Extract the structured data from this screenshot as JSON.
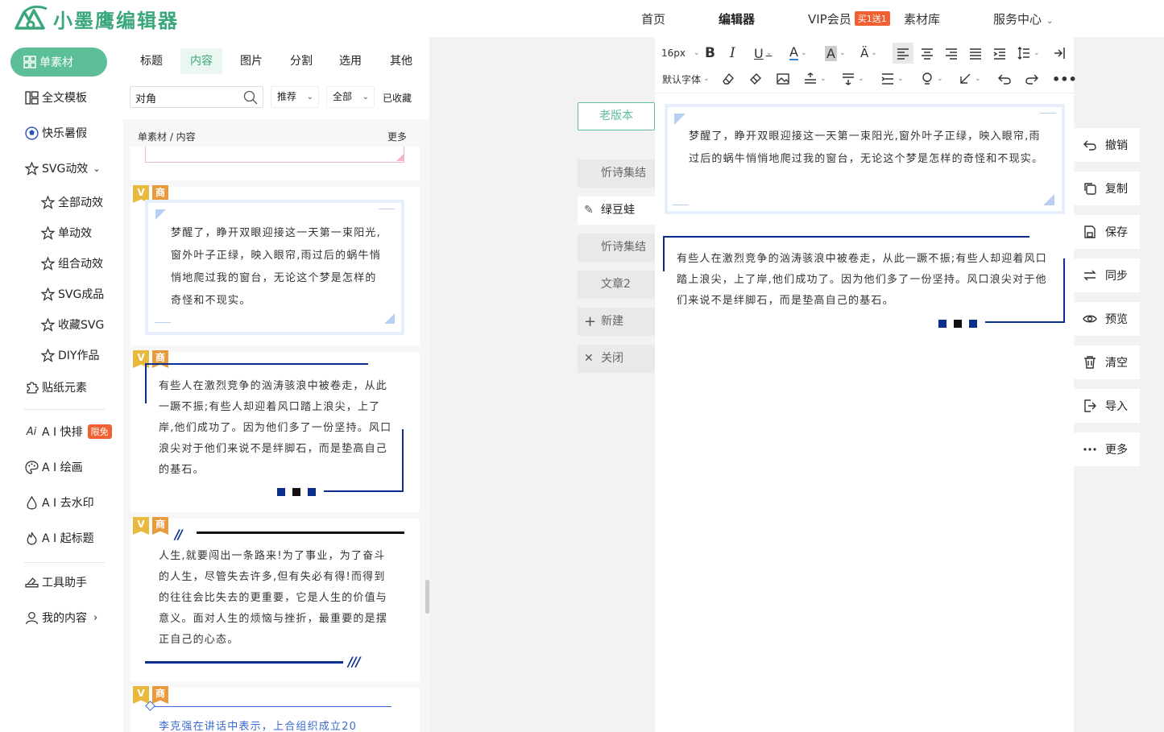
{
  "brand": {
    "name": "小墨鹰编辑器",
    "color": "#3aa77b"
  },
  "nav": {
    "home": "首页",
    "editor": "编辑器",
    "vip": "VIP会员",
    "vip_badge": "买1送1",
    "materials": "素材库",
    "service": "服务中心"
  },
  "sidebar": {
    "active": "单素材",
    "items": [
      {
        "label": "全文模板",
        "icon": "template-icon"
      },
      {
        "label": "快乐暑假",
        "icon": "ball-icon"
      },
      {
        "label": "SVG动效",
        "icon": "star-icon"
      },
      {
        "label": "全部动效",
        "icon": "star-icon"
      },
      {
        "label": "单动效",
        "icon": "star-icon"
      },
      {
        "label": "组合动效",
        "icon": "star-icon"
      },
      {
        "label": "SVG成品",
        "icon": "star-icon"
      },
      {
        "label": "收藏SVG",
        "icon": "star-icon"
      },
      {
        "label": "DIY作品",
        "icon": "star-icon"
      },
      {
        "label": "贴纸元素",
        "icon": "puzzle-icon"
      },
      {
        "label": "A I 快排",
        "icon": "ai-icon",
        "tag": "限免"
      },
      {
        "label": "A I 绘画",
        "icon": "palette-icon"
      },
      {
        "label": "A I 去水印",
        "icon": "drop-icon"
      },
      {
        "label": "A I 起标题",
        "icon": "fire-icon"
      },
      {
        "label": "工具助手",
        "icon": "tools-icon"
      },
      {
        "label": "我的内容",
        "icon": "user-icon"
      }
    ]
  },
  "panel": {
    "tabs": [
      "标题",
      "内容",
      "图片",
      "分割",
      "选用",
      "其他"
    ],
    "active_tab": "内容",
    "search_value": "对角",
    "filter_recommend": "推荐",
    "filter_all": "全部",
    "collected": "已收藏",
    "crumb": "单素材 / 内容",
    "more": "更多",
    "tag_v": "V",
    "tag_s": "商",
    "cards": [
      {
        "text": "梦醒了，睁开双眼迎接这一天第一束阳光,窗外叶子正绿，映入眼帘,雨过后的蜗牛悄悄地爬过我的窗台，无论这个梦是怎样的奇怪和不现实。"
      },
      {
        "text": "有些人在激烈竞争的汹涛骇浪中被卷走，从此一蹶不振;有些人却迎着风口踏上浪尖，上了岸,他们成功了。因为他们多了一份坚持。风口浪尖对于他们来说不是绊脚石，而是垫高自己的基石。"
      },
      {
        "text": "人生,就要闯出一条路来!为了事业，为了奋斗的人生，尽管失去许多,但有失必有得!而得到的往往会比失去的更重要，它是人生的价值与意义。面对人生的烦恼与挫折，最重要的是摆正自己的心态。"
      },
      {
        "text": "李克强在讲话中表示，上合组织成立20"
      }
    ]
  },
  "doc_tabs": {
    "old_version": "老版本",
    "tabs": [
      "忻诗集结",
      "绿豆蛙",
      "忻诗集结",
      "文章2"
    ],
    "new": "新建",
    "close": "关闭"
  },
  "toolbar": {
    "font_size": "16px",
    "font_family": "默认字体"
  },
  "editor": {
    "block1": "梦醒了，睁开双眼迎接这一天第一束阳光,窗外叶子正绿，映入眼帘,雨过后的蜗牛悄悄地爬过我的窗台，无论这个梦是怎样的奇怪和不现实。",
    "block2": "有些人在激烈竞争的汹涛骇浪中被卷走，从此一蹶不振;有些人却迎着风口踏上浪尖，上了岸,他们成功了。因为他们多了一份坚持。风口浪尖对于他们来说不是绊脚石，而是垫高自己的基石。"
  },
  "actions": [
    "撤销",
    "复制",
    "保存",
    "同步",
    "预览",
    "清空",
    "导入",
    "更多"
  ],
  "colors": {
    "accent": "#5dbf97",
    "navy": "#0a2f8f",
    "light_blue": "#c7daf5"
  }
}
